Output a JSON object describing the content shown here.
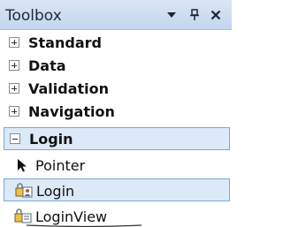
{
  "toolbox": {
    "title": "Toolbox",
    "buttons": {
      "dropdown_icon": "dropdown-arrow-icon",
      "pin_icon": "pin-icon",
      "close_icon": "close-icon"
    },
    "groups": [
      {
        "label": "Standard",
        "expanded": false
      },
      {
        "label": "Data",
        "expanded": false
      },
      {
        "label": "Validation",
        "expanded": false
      },
      {
        "label": "Navigation",
        "expanded": false
      },
      {
        "label": "Login",
        "expanded": true,
        "selected": true
      }
    ],
    "login_items": [
      {
        "label": "Pointer",
        "icon": "pointer-icon",
        "selected": false
      },
      {
        "label": "Login",
        "icon": "login-control-icon",
        "selected": true
      },
      {
        "label": "LoginView",
        "icon": "loginview-icon",
        "selected": false
      }
    ]
  },
  "colors": {
    "titlebar_top": "#d9e6f6",
    "titlebar_bottom": "#c3d6ee",
    "selection_fill": "#dce9f7",
    "selection_border": "#7ba7d6"
  }
}
